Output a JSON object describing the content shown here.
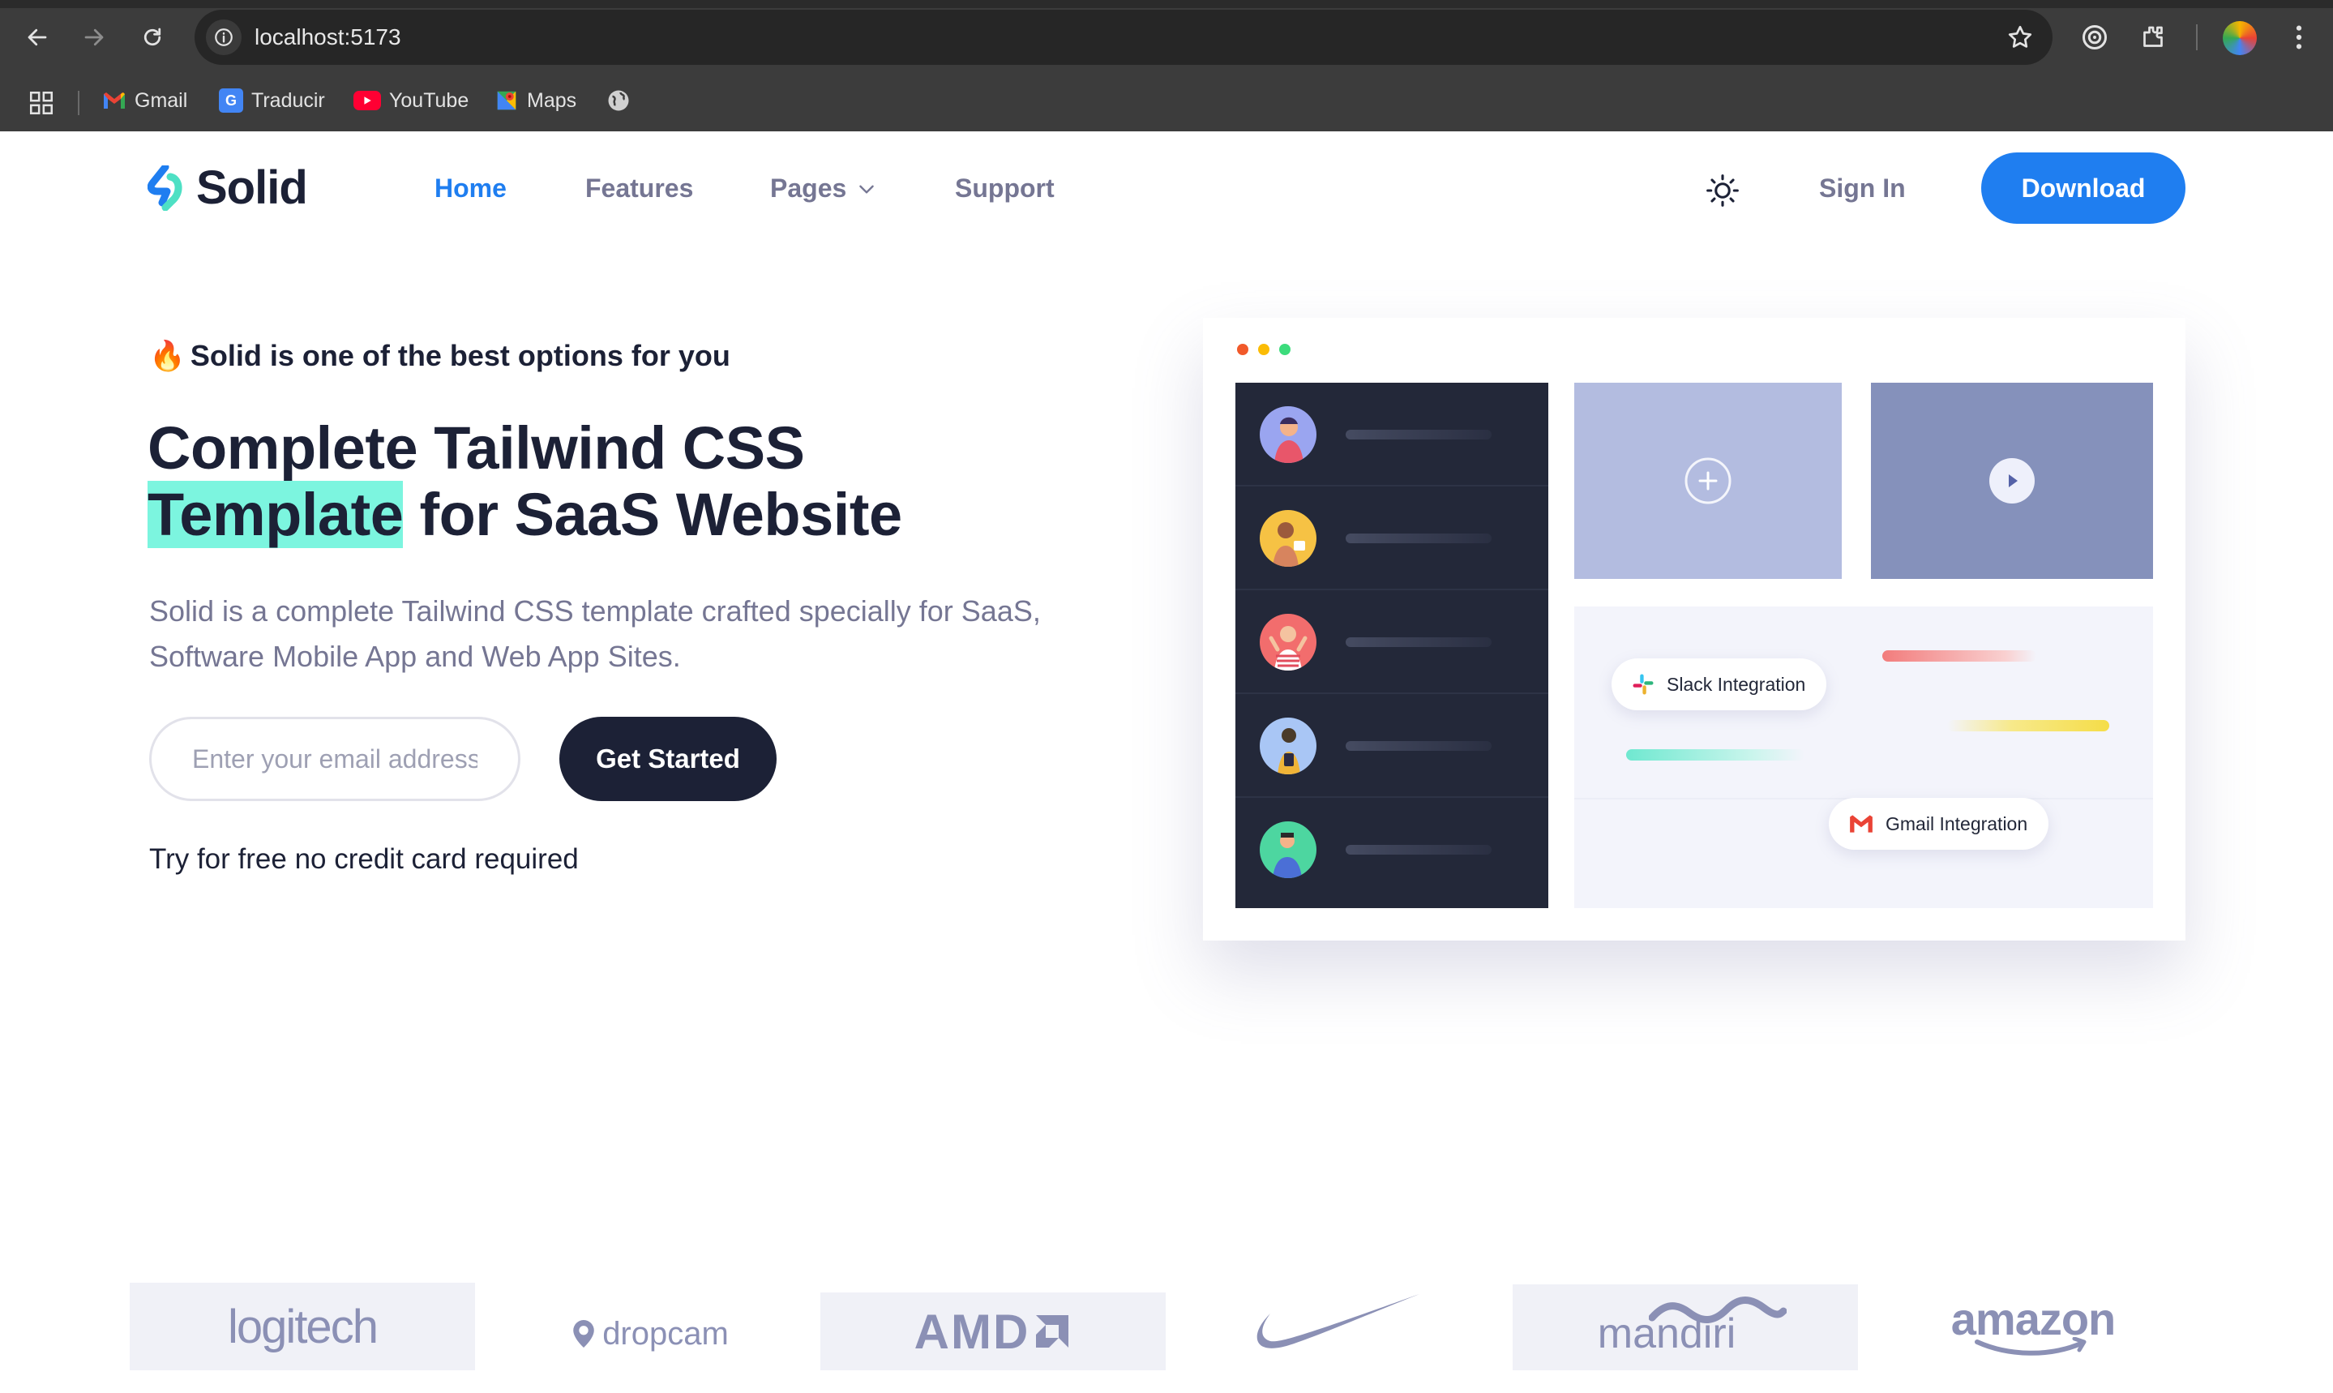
{
  "browser": {
    "url": "localhost:5173",
    "bookmarks": [
      {
        "label": "Gmail",
        "icon": "gmail-icon"
      },
      {
        "label": "Traducir",
        "icon": "translate-icon"
      },
      {
        "label": "YouTube",
        "icon": "youtube-icon"
      },
      {
        "label": "Maps",
        "icon": "maps-icon"
      }
    ]
  },
  "site": {
    "logo_text": "Solid",
    "nav": {
      "home": "Home",
      "features": "Features",
      "pages": "Pages",
      "support": "Support"
    },
    "sign_in": "Sign In",
    "download": "Download"
  },
  "hero": {
    "kicker_emoji": "🔥",
    "kicker": "Solid is one of the best options for you",
    "title_line1": "Complete Tailwind CSS",
    "title_highlight": "Template",
    "title_rest": " for SaaS Website",
    "description": "Solid is a complete Tailwind CSS template crafted specially for SaaS, Software Mobile App and Web App Sites.",
    "email_placeholder": "Enter your email address",
    "cta": "Get Started",
    "note": "Try for free no credit card required"
  },
  "illustration": {
    "chip_slack": "Slack Integration",
    "chip_gmail": "Gmail Integration"
  },
  "brands": {
    "logitech": "logitech",
    "dropcam": "dropcam",
    "amd": "AMD",
    "nike": "nike-logo",
    "mandiri": "mandiri",
    "amazon": "amazon"
  },
  "colors": {
    "primary": "#1f7ef0",
    "dark": "#1c2136",
    "muted": "#757693",
    "highlight": "#7cf5df",
    "brand_gray": "#8b90b5"
  }
}
